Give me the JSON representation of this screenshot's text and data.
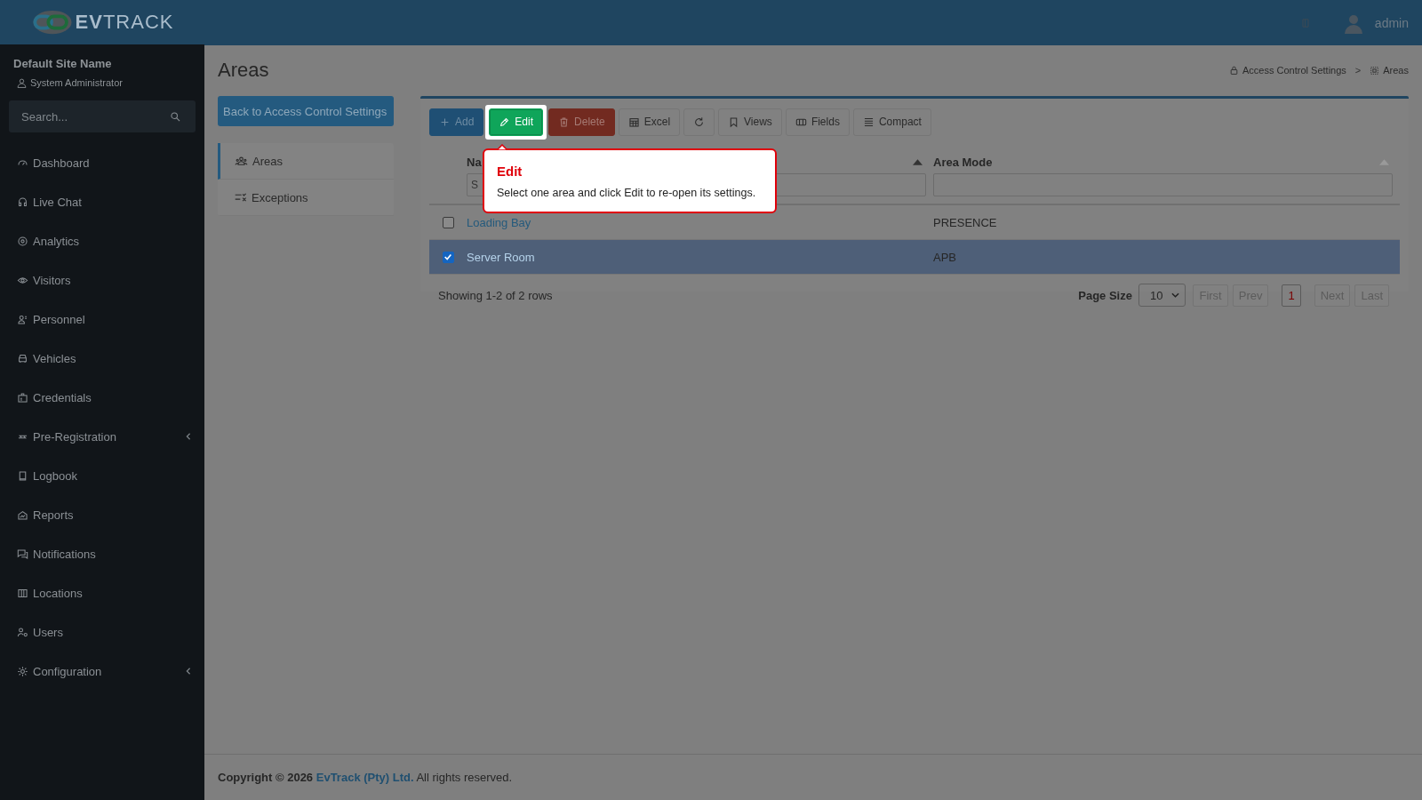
{
  "header": {
    "logo": "**EV**TRACK",
    "user": "admin"
  },
  "sidebar": {
    "site": "Default Site Name",
    "role": "System Administrator",
    "search": {
      "placeholder": "Search..."
    },
    "items": [
      {
        "label": "Dashboard",
        "expandable": false
      },
      {
        "label": "Live Chat",
        "expandable": false
      },
      {
        "label": "Analytics",
        "expandable": false
      },
      {
        "label": "Visitors",
        "expandable": false
      },
      {
        "label": "Personnel",
        "expandable": false
      },
      {
        "label": "Vehicles",
        "expandable": false
      },
      {
        "label": "Credentials",
        "expandable": false
      },
      {
        "label": "Pre-Registration",
        "expandable": true
      },
      {
        "label": "Logbook",
        "expandable": false
      },
      {
        "label": "Reports",
        "expandable": false
      },
      {
        "label": "Notifications",
        "expandable": false
      },
      {
        "label": "Locations",
        "expandable": false
      },
      {
        "label": "Users",
        "expandable": false
      },
      {
        "label": "Configuration",
        "expandable": true
      }
    ]
  },
  "page": {
    "title": "Areas",
    "breadcrumb": [
      "Access Control Settings",
      "Areas"
    ],
    "separator": ">"
  },
  "back_button": "Back to Access Control Settings",
  "submenu": [
    {
      "label": "Areas",
      "selected": true
    },
    {
      "label": "Exceptions",
      "selected": false
    }
  ],
  "toolbar": [
    {
      "kind": "add",
      "label": "Add",
      "highlighted": false
    },
    {
      "kind": "edit",
      "label": "Edit",
      "highlighted": true
    },
    {
      "kind": "delete",
      "label": "Delete",
      "highlighted": false
    },
    {
      "kind": "excel",
      "label": "Excel",
      "highlighted": false
    },
    {
      "kind": "refresh",
      "highlighted": false
    },
    {
      "kind": "views",
      "label": "Views",
      "highlighted": false
    },
    {
      "kind": "fields",
      "label": "Fields",
      "highlighted": false
    },
    {
      "kind": "compact",
      "label": "Compact",
      "highlighted": false
    }
  ],
  "tooltip": {
    "title": "Edit",
    "text": "Select one area and click Edit to re-open its settings."
  },
  "table": {
    "columns": [
      {
        "header": "Na",
        "filter_placeholder": "S"
      },
      {
        "header": "Area Mode"
      }
    ],
    "rows": [
      {
        "name": "Loading Bay",
        "mode": "PRESENCE",
        "checked": false,
        "selected": false
      },
      {
        "name": "Server Room",
        "mode": "APB",
        "checked": true,
        "selected": true
      }
    ]
  },
  "pagination": {
    "summary": "Showing 1-2 of 2 rows",
    "page_size_label": "Page Size",
    "page_size": "10",
    "buttons": [
      {
        "label": "First",
        "disabled": true,
        "selected": false
      },
      {
        "label": "Prev",
        "disabled": true,
        "selected": false
      },
      {
        "label": "1",
        "disabled": false,
        "selected": true
      },
      {
        "label": "Next",
        "disabled": true,
        "selected": false
      },
      {
        "label": "Last",
        "disabled": true,
        "selected": false
      }
    ]
  },
  "footer": {
    "prefix": "Copyright © 2026",
    "link": "EvTrack (Pty) Ltd.",
    "suffix": "All rights reserved."
  }
}
